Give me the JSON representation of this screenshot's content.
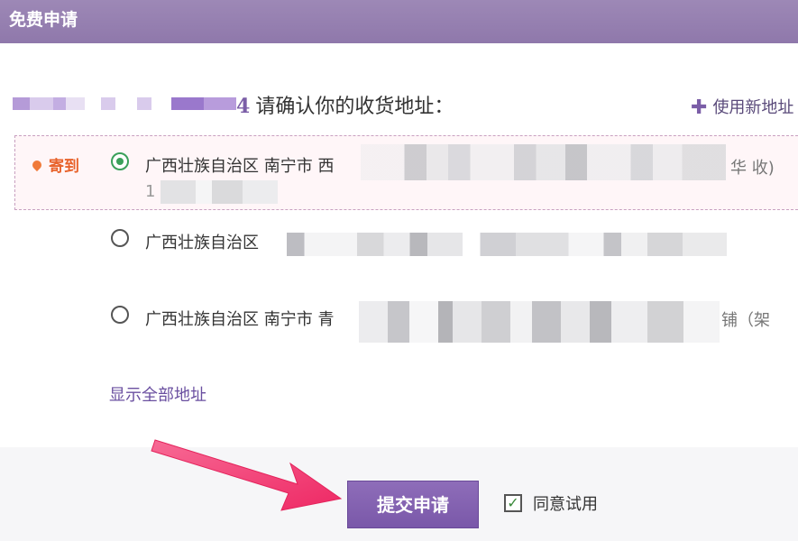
{
  "header": {
    "title": "免费申请"
  },
  "step": {
    "number": "4",
    "text": "请确认你的收货地址："
  },
  "add_new": {
    "label": "使用新地址",
    "icon": "plus-icon"
  },
  "ship_to": {
    "label": "寄到",
    "icon": "map-pin-icon"
  },
  "addresses": [
    {
      "prefix": "广西壮族自治区 南宁市 西",
      "suffix": "华 收)",
      "line2_prefix": "1",
      "selected": true
    },
    {
      "prefix": "广西壮族自治区 ",
      "suffix": "",
      "selected": false
    },
    {
      "prefix": "广西壮族自治区 南宁市 青",
      "suffix": "铺（架",
      "selected": false
    }
  ],
  "show_all": {
    "label": "显示全部地址"
  },
  "footer": {
    "submit_label": "提交申请",
    "agree_label": "同意试用",
    "agree_checked": true,
    "check_mark": "✓"
  },
  "colors": {
    "header": "#9480ad",
    "accent": "#7b5ea7",
    "ship_label": "#e8632c",
    "arrow": "#f0306a"
  }
}
